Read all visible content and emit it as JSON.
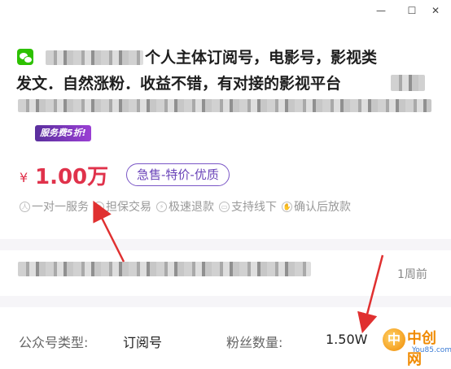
{
  "window": {
    "minimize_glyph": "—",
    "maximize_glyph": "☐",
    "close_glyph": "✕"
  },
  "listing": {
    "title_line1": "个人主体订阅号，电影号，影视类",
    "title_line2": "发文．自然涨粉．收益不错，有对接的影视平台",
    "badge": "服务费5折!",
    "currency": "¥",
    "price": "1.00万",
    "tag": "急售-特价-优质",
    "features": [
      "一对一服务",
      "担保交易",
      "极速退款",
      "支持线下",
      "确认后放款"
    ],
    "time_ago": "1周前",
    "fields": [
      {
        "label": "公众号类型:",
        "value": "订阅号"
      },
      {
        "label": "粉丝数量:",
        "value": "1.50W"
      }
    ]
  },
  "watermark": {
    "logo_char": "中",
    "name": "中创网",
    "domain": "You85.com"
  },
  "colors": {
    "price": "#e0324b",
    "tag_border": "#7a56c6",
    "arrow": "#e03030",
    "separator": "#f6f5f8"
  }
}
